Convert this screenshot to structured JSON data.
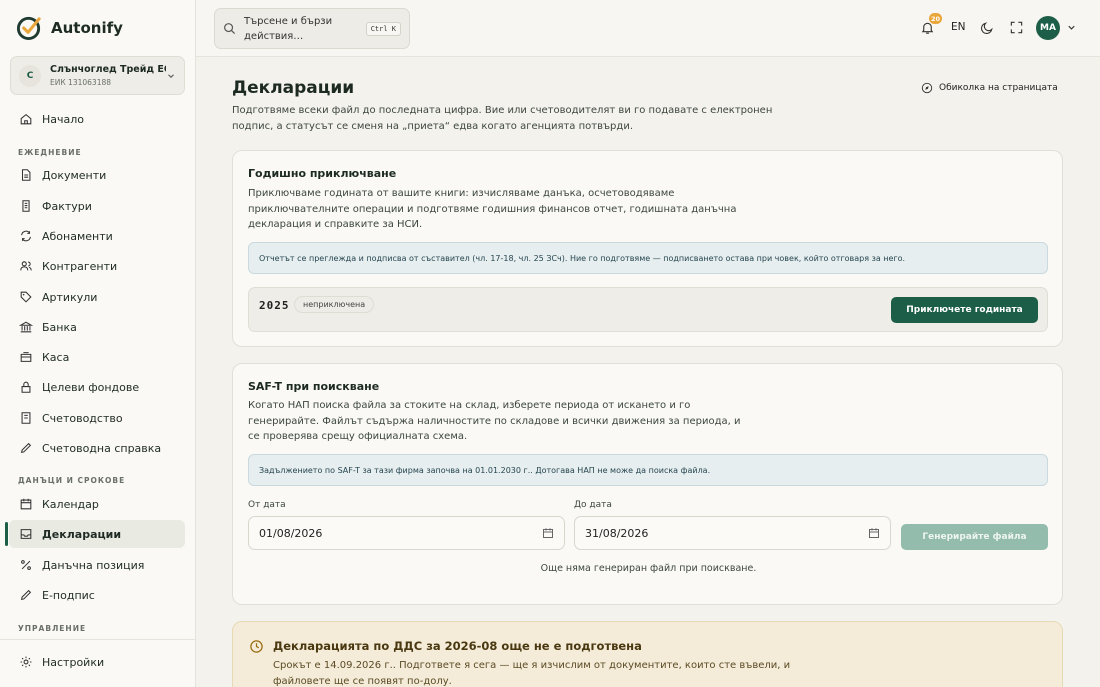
{
  "app": {
    "name": "Autonify"
  },
  "company": {
    "initial": "С",
    "name": "Слънчоглед Трейд ЕООД",
    "eik": "ЕИК 131063188"
  },
  "nav": {
    "home": "Начало",
    "section_daily": "ЕЖЕДНЕВИЕ",
    "documents": "Документи",
    "invoices": "Фактури",
    "subscriptions": "Абонаменти",
    "contractors": "Контрагенти",
    "articles": "Артикули",
    "bank": "Банка",
    "cash": "Каса",
    "funds": "Целеви фондове",
    "accounting": "Счетоводство",
    "report": "Счетоводна справка",
    "section_taxes": "ДАНЪЦИ И СРОКОВЕ",
    "calendar": "Календар",
    "declarations": "Декларации",
    "tax_position": "Данъчна позиция",
    "esign": "Е-подпис",
    "section_manage": "УПРАВЛЕНИЕ",
    "settings": "Настройки"
  },
  "topbar": {
    "search_placeholder": "Търсене и бързи действия…",
    "shortcut": "Ctrl K",
    "notifications_count": "20",
    "language": "EN",
    "user_initials": "МА"
  },
  "page": {
    "title": "Декларации",
    "tour": "Обиколка на страницата",
    "description": "Подготвяме всеки файл до последната цифра. Вие или счетоводителят ви го подавате с електронен подпис, а статусът се сменя на „приета“ едва когато агенцията потвърди."
  },
  "annual": {
    "title": "Годишно приключване",
    "text": "Приключваме годината от вашите книги: изчисляваме данъка, осчетоводяваме приключвателните операции и подготвяме годишния финансов отчет, годишната данъчна декларация и справките за НСИ.",
    "info": "Отчетът се преглежда и подписва от съставител (чл. 17-18, чл. 25 ЗСч). Ние го подготвяме — подписването остава при човек, който отговаря за него.",
    "year": "2025",
    "status": "неприключена",
    "button": "Приключете годината"
  },
  "saft": {
    "title": "SAF-T при поискване",
    "text": "Когато НАП поиска файла за стоките на склад, изберете периода от искането и го генерирайте. Файлът съдържа наличностите по складове и всички движения за периода, и се проверява срещу официалната схема.",
    "info": "Задължението по SAF-T за тази фирма започва на 01.01.2030 г.. Дотогава НАП не може да поиска файла.",
    "from_label": "От дата",
    "from_value": "01/08/2026",
    "to_label": "До дата",
    "to_value": "31/08/2026",
    "button": "Генерирайте файла",
    "empty": "Още няма генериран файл при поискване."
  },
  "vat_warning": {
    "title": "Декларацията по ДДС за 2026-08 още не е подготвена",
    "text": "Срокът е 14.09.2026 г.. Подгответе я сега — ще я изчислим от документите, които сте въвели, и файловете ще се появят по-долу."
  },
  "colors": {
    "brand": "#1d5e48",
    "badge": "#e9a63b",
    "warning_bg": "#f4ecd8",
    "info_bg": "#e6eef0"
  }
}
